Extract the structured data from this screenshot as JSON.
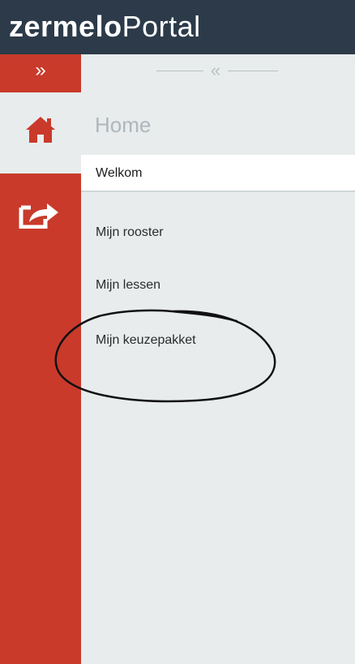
{
  "header": {
    "logo_brand": "zermelo",
    "logo_product": "Portal"
  },
  "rail": {
    "expand_label": "»",
    "items": [
      {
        "name": "home",
        "icon": "home-icon",
        "active": true
      },
      {
        "name": "share",
        "icon": "share-icon",
        "active": false
      }
    ]
  },
  "panel": {
    "collapse_label": "«",
    "section_title": "Home",
    "menu": [
      {
        "label": "Welkom",
        "active": true
      },
      {
        "label": "Mijn rooster",
        "active": false
      },
      {
        "label": "Mijn lessen",
        "active": false
      },
      {
        "label": "Mijn keuzepakket",
        "active": false
      }
    ]
  },
  "colors": {
    "header_bg": "#2c3a49",
    "rail_red": "#c93a2b",
    "panel_bg": "#e8eced",
    "active_item_bg": "#ffffff"
  }
}
